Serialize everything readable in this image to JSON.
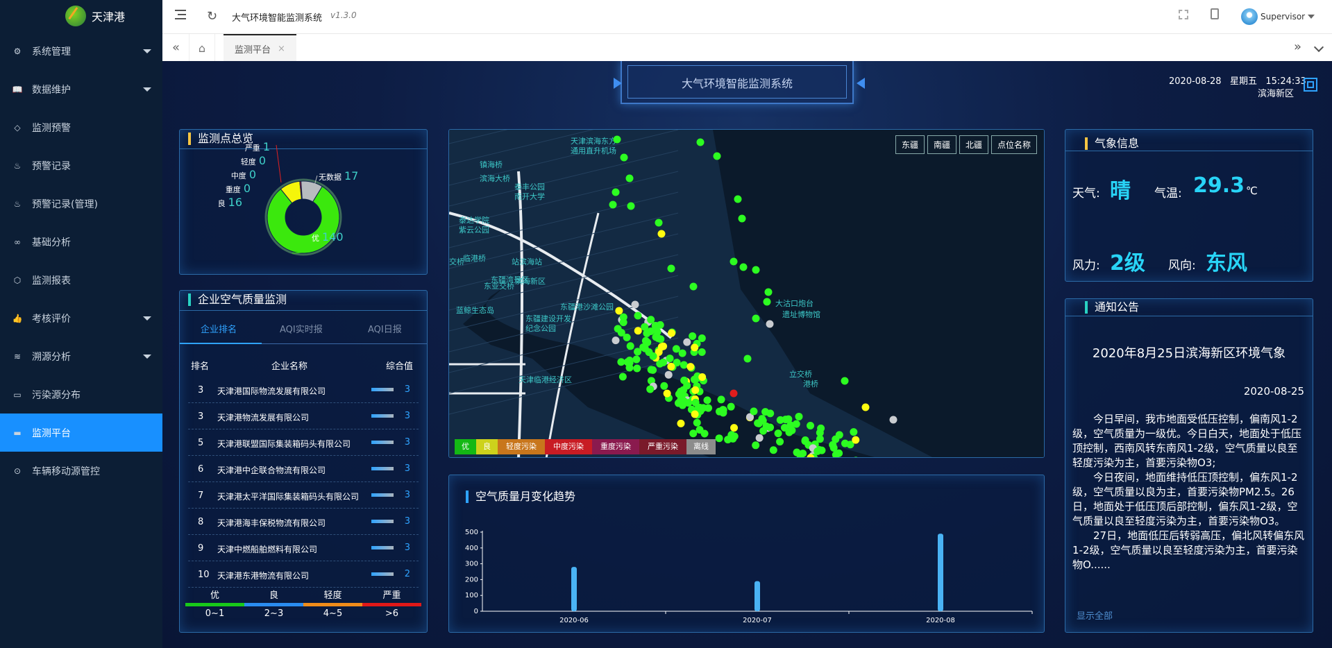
{
  "sidebar": {
    "brand": "天津港",
    "items": [
      {
        "label": "系统管理",
        "icon": "gear-icon",
        "expand": true
      },
      {
        "label": "数据维护",
        "icon": "book-icon",
        "expand": true
      },
      {
        "label": "监测预警",
        "icon": "shield-icon",
        "expand": false
      },
      {
        "label": "预警记录",
        "icon": "fire-icon",
        "expand": false
      },
      {
        "label": "预警记录(管理)",
        "icon": "fire-icon",
        "expand": false
      },
      {
        "label": "基础分析",
        "icon": "infinity-icon",
        "expand": false
      },
      {
        "label": "监测报表",
        "icon": "cube-icon",
        "expand": false
      },
      {
        "label": "考核评价",
        "icon": "thumb-icon",
        "expand": true
      },
      {
        "label": "溯源分析",
        "icon": "layers-icon",
        "expand": true
      },
      {
        "label": "污染源分布",
        "icon": "image-icon",
        "expand": false
      },
      {
        "label": "监测平台",
        "icon": "monitor-icon",
        "expand": false,
        "active": true
      },
      {
        "label": "车辆移动源管控",
        "icon": "location-icon",
        "expand": false
      }
    ]
  },
  "topbar": {
    "title": "大气环境智能监测系统",
    "version": "v1.3.0",
    "user": "Supervisor"
  },
  "tabs": {
    "current": "监测平台",
    "close": "×"
  },
  "header": {
    "title": "大气环境智能监测系统",
    "date": "2020-08-28",
    "weekday": "星期五",
    "time": "15:24:33",
    "district": "滨海新区"
  },
  "overview": {
    "title": "监测点总览",
    "labels": [
      {
        "name": "严重",
        "value": "1"
      },
      {
        "name": "轻度",
        "value": "0"
      },
      {
        "name": "中度",
        "value": "0"
      },
      {
        "name": "重度",
        "value": "0"
      },
      {
        "name": "良",
        "value": "16"
      },
      {
        "name": "无数据",
        "value": "17"
      },
      {
        "name": "优",
        "value": "140"
      }
    ],
    "segments": [
      {
        "name": "优",
        "value": 140,
        "color": "#3be80d"
      },
      {
        "name": "良",
        "value": 16,
        "color": "#f5f50a"
      },
      {
        "name": "严重",
        "value": 1,
        "color": "#e02020"
      },
      {
        "name": "无数据",
        "value": 17,
        "color": "#b8bcc0"
      }
    ]
  },
  "aq": {
    "title": "企业空气质量监测",
    "tabs": [
      "企业排名",
      "AQI实时报",
      "AQI日报"
    ],
    "headers": [
      "排名",
      "企业名称",
      "综合值"
    ],
    "rows": [
      {
        "rank": "3",
        "name": "天津港国际物流发展有限公司",
        "value": "3"
      },
      {
        "rank": "3",
        "name": "天津港物流发展有限公司",
        "value": "3"
      },
      {
        "rank": "5",
        "name": "天津港联盟国际集装箱码头有限公司",
        "value": "3"
      },
      {
        "rank": "6",
        "name": "天津港中企联合物流有限公司",
        "value": "3"
      },
      {
        "rank": "7",
        "name": "天津港太平洋国际集装箱码头有限公司",
        "value": "3"
      },
      {
        "rank": "8",
        "name": "天津港海丰保税物流有限公司",
        "value": "3"
      },
      {
        "rank": "9",
        "name": "天津中燃船舶燃料有限公司",
        "value": "3"
      },
      {
        "rank": "10",
        "name": "天津港东港物流有限公司",
        "value": "2"
      }
    ],
    "legend": [
      {
        "name": "优",
        "range": "0~1",
        "color": "#18c91a"
      },
      {
        "name": "良",
        "range": "2~3",
        "color": "#2a8cf0"
      },
      {
        "name": "轻度",
        "range": "4~5",
        "color": "#f08c1a"
      },
      {
        "name": "严重",
        "range": ">6",
        "color": "#e01818"
      }
    ]
  },
  "map": {
    "buttons": [
      "东疆",
      "南疆",
      "北疆",
      "点位名称"
    ],
    "places": [
      "天津滨海东方",
      "通用直升机场",
      "镇海桥",
      "滨海大桥",
      "泰丰公园",
      "南开大学",
      "泰达学院",
      "紫云公园",
      "交桥",
      "临港桥",
      "站滨海站",
      "滨海新区",
      "东疆湾景区",
      "东疆港沙滩公园",
      "蓝鲸生态岛",
      "东亚交桥",
      "大沽口炮台",
      "遗址博物馆",
      "东疆建设开发",
      "纪念公园",
      "立交桥",
      "港桥",
      "天津临港经济区"
    ],
    "legend": [
      {
        "name": "优",
        "color": "#14b814"
      },
      {
        "name": "良",
        "color": "#cdd21c"
      },
      {
        "name": "轻度污染",
        "color": "#c8761c"
      },
      {
        "name": "中度污染",
        "color": "#c81c24"
      },
      {
        "name": "重度污染",
        "color": "#8a1a4e"
      },
      {
        "name": "严重污染",
        "color": "#7a1a2a"
      },
      {
        "name": "离线",
        "color": "#8c8c8c"
      }
    ]
  },
  "weather": {
    "title": "气象信息",
    "weather_label": "天气:",
    "weather": "晴",
    "temp_label": "气温:",
    "temp": "29.3",
    "unit": "℃",
    "wind_label": "风力:",
    "wind": "2级",
    "dir_label": "风向:",
    "dir": "东风"
  },
  "notice": {
    "title": "通知公告",
    "heading": "2020年8月25日滨海新区环境气象",
    "date": "2020-08-25",
    "p1": "今日早间，我市地面受低压控制，偏南风1-2级，空气质量为一级优。今日白天，地面处于低压顶控制，西南风转东南风1-2级，空气质量以良至轻度污染为主，首要污染物O3;",
    "p2": "今日夜间，地面维持低压顶控制，偏东风1-2级，空气质量以良为主，首要污染物PM2.5。26日，地面处于低压顶后部控制，偏东风1-2级，空气质量以良至轻度污染为主，首要污染物O3。",
    "p3": "27日，地面低压后转弱高压，偏北风转偏东风1-2级，空气质量以良至轻度污染为主，首要污染物O......",
    "more": "显示全部"
  },
  "trend": {
    "title": "空气质量月变化趋势"
  },
  "chart_data": {
    "type": "bar",
    "categories": [
      "2020-06",
      "2020-07",
      "2020-08"
    ],
    "values": [
      280,
      190,
      490
    ],
    "ylim": [
      0,
      500
    ],
    "yticks": [
      "0",
      "100",
      "200",
      "300",
      "400",
      "500"
    ],
    "color": "#4ab3f4"
  }
}
